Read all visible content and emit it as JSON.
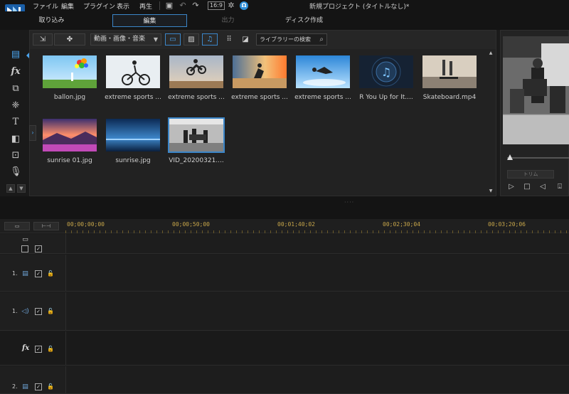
{
  "menubar": {
    "items": [
      "ファイル",
      "編集",
      "プラグイン",
      "表示",
      "再生"
    ],
    "aspect_ratio": "16:9",
    "user_badge": "Ω",
    "project_title": "新規プロジェクト (タイトルなし)*"
  },
  "tabs": [
    {
      "label": "取り込み",
      "state": "normal"
    },
    {
      "label": "編集",
      "state": "active"
    },
    {
      "label": "出力",
      "state": "disabled"
    },
    {
      "label": "ディスク作成",
      "state": "normal"
    }
  ],
  "library": {
    "filter_label": "動画・画像・音楽",
    "search_placeholder": "ライブラリーの検索",
    "items": [
      {
        "label": "ballon.jpg",
        "thumb": "balloon"
      },
      {
        "label": "extreme sports ...",
        "thumb": "bmx"
      },
      {
        "label": "extreme sports ...",
        "thumb": "moto"
      },
      {
        "label": "extreme sports ...",
        "thumb": "beach"
      },
      {
        "label": "extreme sports ...",
        "thumb": "skydive"
      },
      {
        "label": "R You Up for It....",
        "thumb": "music"
      },
      {
        "label": "Skateboard.mp4",
        "thumb": "skate"
      },
      {
        "label": "sunrise 01.jpg",
        "thumb": "sunrise"
      },
      {
        "label": "sunrise.jpg",
        "thumb": "sea"
      },
      {
        "label": "VID_20200321....",
        "thumb": "street"
      }
    ]
  },
  "preview": {
    "trim_label": "トリム"
  },
  "timeline": {
    "timecodes": [
      "00;00;00;00",
      "00;00;50;00",
      "00;01;40;02",
      "00;02;30;04",
      "00;03;20;06"
    ],
    "tracks": [
      {
        "number": "1."
      },
      {
        "number": "1."
      },
      {
        "number": "2."
      }
    ],
    "fx_label": "fx",
    "check_mark": "✓",
    "lock_glyph": "🔓"
  },
  "colors": {
    "accent": "#3b86c9",
    "accent_light": "#4aa3ee",
    "timecode": "#c7a64a",
    "background": "#1b1b1b"
  }
}
